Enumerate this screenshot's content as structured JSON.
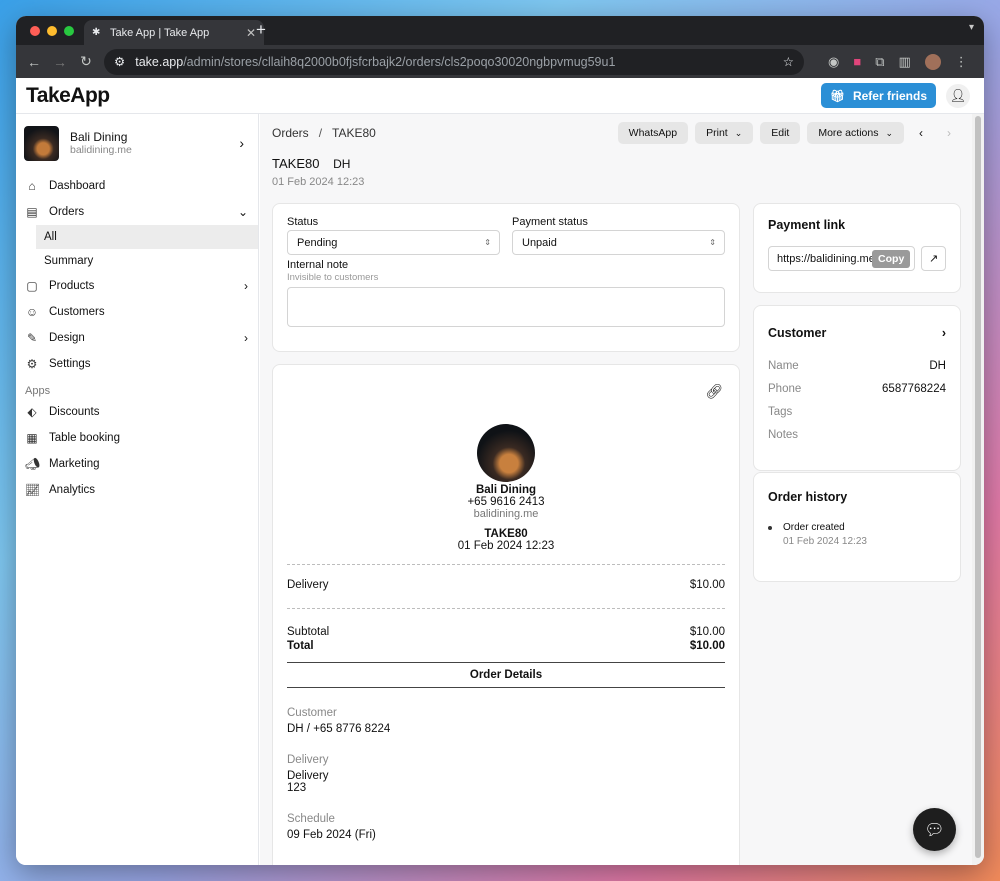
{
  "browser": {
    "tab_title": "Take App | Take App",
    "url_host": "take.app",
    "url_path": "/admin/stores/cllaih8q2000b0fjsfcrbajk2/orders/cls2poqo30020ngbpvmug59u1"
  },
  "header": {
    "logo": "TakeApp",
    "refer_label": "Refer friends"
  },
  "sidebar": {
    "store_name": "Bali Dining",
    "store_domain": "balidining.me",
    "items": {
      "dashboard": "Dashboard",
      "orders": "Orders",
      "orders_all": "All",
      "orders_summary": "Summary",
      "products": "Products",
      "customers": "Customers",
      "design": "Design",
      "settings": "Settings"
    },
    "apps_label": "Apps",
    "apps": {
      "discounts": "Discounts",
      "table_booking": "Table booking",
      "marketing": "Marketing",
      "analytics": "Analytics"
    }
  },
  "toolbar": {
    "crumb_orders": "Orders",
    "crumb_sep": "/",
    "crumb_current": "TAKE80",
    "whatsapp": "WhatsApp",
    "print": "Print",
    "edit": "Edit",
    "more": "More actions"
  },
  "order": {
    "id": "TAKE80",
    "initials": "DH",
    "date": "01 Feb 2024 12:23"
  },
  "status_card": {
    "status_label": "Status",
    "status_value": "Pending",
    "payment_label": "Payment status",
    "payment_value": "Unpaid",
    "note_label": "Internal note",
    "note_hint": "Invisible to customers",
    "note_value": ""
  },
  "receipt": {
    "store_name": "Bali Dining",
    "phone": "+65 9616 2413",
    "website": "balidining.me",
    "code": "TAKE80",
    "date": "01 Feb 2024 12:23",
    "delivery_label": "Delivery",
    "delivery_amount": "$10.00",
    "subtotal_label": "Subtotal",
    "subtotal_amount": "$10.00",
    "total_label": "Total",
    "total_amount": "$10.00",
    "details_title": "Order Details",
    "customer_label": "Customer",
    "customer_value": "DH / +65 8776 8224",
    "delivery_section_label": "Delivery",
    "delivery_method": "Delivery",
    "delivery_address": "123",
    "schedule_label": "Schedule",
    "schedule_value": "09 Feb 2024 (Fri)"
  },
  "payment_link": {
    "title": "Payment link",
    "url": "https://balidining.me",
    "copy_label": "Copy"
  },
  "customer_card": {
    "title": "Customer",
    "name_label": "Name",
    "name_value": "DH",
    "phone_label": "Phone",
    "phone_value": "6587768224",
    "tags_label": "Tags",
    "notes_label": "Notes"
  },
  "history": {
    "title": "Order history",
    "event": "Order created",
    "event_date": "01 Feb 2024 12:23"
  },
  "colors": {
    "accent": "#2b8fd6",
    "tab_bar": "#202124"
  }
}
